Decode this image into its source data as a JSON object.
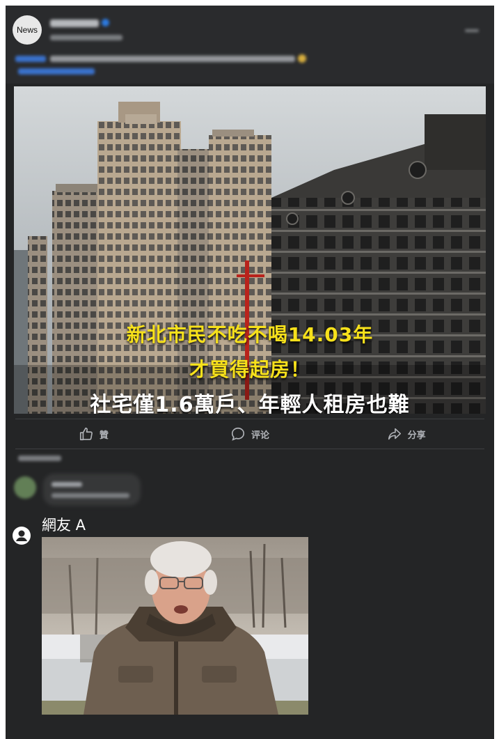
{
  "post": {
    "avatar_text": "News",
    "image_caption": {
      "line1": "新北市民不吃不喝14.03年",
      "line2": "才買得起房！",
      "line3": "社宅僅1.6萬戶、年輕人租房也難"
    }
  },
  "actions": {
    "like_label": "贊",
    "comment_label": "评论",
    "share_label": "分享"
  },
  "comment": {
    "username": "網友 A"
  }
}
